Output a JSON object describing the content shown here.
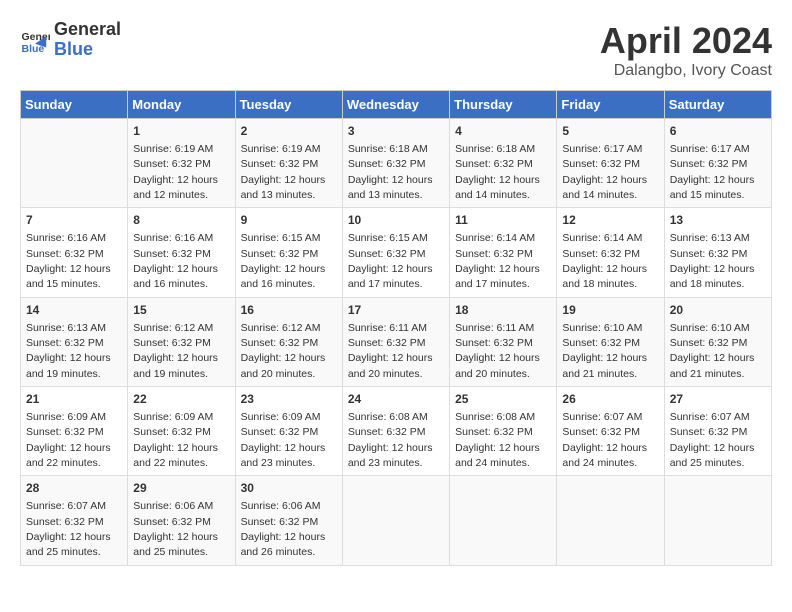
{
  "header": {
    "logo_line1": "General",
    "logo_line2": "Blue",
    "main_title": "April 2024",
    "subtitle": "Dalangbo, Ivory Coast"
  },
  "calendar": {
    "days_of_week": [
      "Sunday",
      "Monday",
      "Tuesday",
      "Wednesday",
      "Thursday",
      "Friday",
      "Saturday"
    ],
    "weeks": [
      [
        {
          "day": "",
          "info": ""
        },
        {
          "day": "1",
          "info": "Sunrise: 6:19 AM\nSunset: 6:32 PM\nDaylight: 12 hours\nand 12 minutes."
        },
        {
          "day": "2",
          "info": "Sunrise: 6:19 AM\nSunset: 6:32 PM\nDaylight: 12 hours\nand 13 minutes."
        },
        {
          "day": "3",
          "info": "Sunrise: 6:18 AM\nSunset: 6:32 PM\nDaylight: 12 hours\nand 13 minutes."
        },
        {
          "day": "4",
          "info": "Sunrise: 6:18 AM\nSunset: 6:32 PM\nDaylight: 12 hours\nand 14 minutes."
        },
        {
          "day": "5",
          "info": "Sunrise: 6:17 AM\nSunset: 6:32 PM\nDaylight: 12 hours\nand 14 minutes."
        },
        {
          "day": "6",
          "info": "Sunrise: 6:17 AM\nSunset: 6:32 PM\nDaylight: 12 hours\nand 15 minutes."
        }
      ],
      [
        {
          "day": "7",
          "info": "Sunrise: 6:16 AM\nSunset: 6:32 PM\nDaylight: 12 hours\nand 15 minutes."
        },
        {
          "day": "8",
          "info": "Sunrise: 6:16 AM\nSunset: 6:32 PM\nDaylight: 12 hours\nand 16 minutes."
        },
        {
          "day": "9",
          "info": "Sunrise: 6:15 AM\nSunset: 6:32 PM\nDaylight: 12 hours\nand 16 minutes."
        },
        {
          "day": "10",
          "info": "Sunrise: 6:15 AM\nSunset: 6:32 PM\nDaylight: 12 hours\nand 17 minutes."
        },
        {
          "day": "11",
          "info": "Sunrise: 6:14 AM\nSunset: 6:32 PM\nDaylight: 12 hours\nand 17 minutes."
        },
        {
          "day": "12",
          "info": "Sunrise: 6:14 AM\nSunset: 6:32 PM\nDaylight: 12 hours\nand 18 minutes."
        },
        {
          "day": "13",
          "info": "Sunrise: 6:13 AM\nSunset: 6:32 PM\nDaylight: 12 hours\nand 18 minutes."
        }
      ],
      [
        {
          "day": "14",
          "info": "Sunrise: 6:13 AM\nSunset: 6:32 PM\nDaylight: 12 hours\nand 19 minutes."
        },
        {
          "day": "15",
          "info": "Sunrise: 6:12 AM\nSunset: 6:32 PM\nDaylight: 12 hours\nand 19 minutes."
        },
        {
          "day": "16",
          "info": "Sunrise: 6:12 AM\nSunset: 6:32 PM\nDaylight: 12 hours\nand 20 minutes."
        },
        {
          "day": "17",
          "info": "Sunrise: 6:11 AM\nSunset: 6:32 PM\nDaylight: 12 hours\nand 20 minutes."
        },
        {
          "day": "18",
          "info": "Sunrise: 6:11 AM\nSunset: 6:32 PM\nDaylight: 12 hours\nand 20 minutes."
        },
        {
          "day": "19",
          "info": "Sunrise: 6:10 AM\nSunset: 6:32 PM\nDaylight: 12 hours\nand 21 minutes."
        },
        {
          "day": "20",
          "info": "Sunrise: 6:10 AM\nSunset: 6:32 PM\nDaylight: 12 hours\nand 21 minutes."
        }
      ],
      [
        {
          "day": "21",
          "info": "Sunrise: 6:09 AM\nSunset: 6:32 PM\nDaylight: 12 hours\nand 22 minutes."
        },
        {
          "day": "22",
          "info": "Sunrise: 6:09 AM\nSunset: 6:32 PM\nDaylight: 12 hours\nand 22 minutes."
        },
        {
          "day": "23",
          "info": "Sunrise: 6:09 AM\nSunset: 6:32 PM\nDaylight: 12 hours\nand 23 minutes."
        },
        {
          "day": "24",
          "info": "Sunrise: 6:08 AM\nSunset: 6:32 PM\nDaylight: 12 hours\nand 23 minutes."
        },
        {
          "day": "25",
          "info": "Sunrise: 6:08 AM\nSunset: 6:32 PM\nDaylight: 12 hours\nand 24 minutes."
        },
        {
          "day": "26",
          "info": "Sunrise: 6:07 AM\nSunset: 6:32 PM\nDaylight: 12 hours\nand 24 minutes."
        },
        {
          "day": "27",
          "info": "Sunrise: 6:07 AM\nSunset: 6:32 PM\nDaylight: 12 hours\nand 25 minutes."
        }
      ],
      [
        {
          "day": "28",
          "info": "Sunrise: 6:07 AM\nSunset: 6:32 PM\nDaylight: 12 hours\nand 25 minutes."
        },
        {
          "day": "29",
          "info": "Sunrise: 6:06 AM\nSunset: 6:32 PM\nDaylight: 12 hours\nand 25 minutes."
        },
        {
          "day": "30",
          "info": "Sunrise: 6:06 AM\nSunset: 6:32 PM\nDaylight: 12 hours\nand 26 minutes."
        },
        {
          "day": "",
          "info": ""
        },
        {
          "day": "",
          "info": ""
        },
        {
          "day": "",
          "info": ""
        },
        {
          "day": "",
          "info": ""
        }
      ]
    ]
  }
}
